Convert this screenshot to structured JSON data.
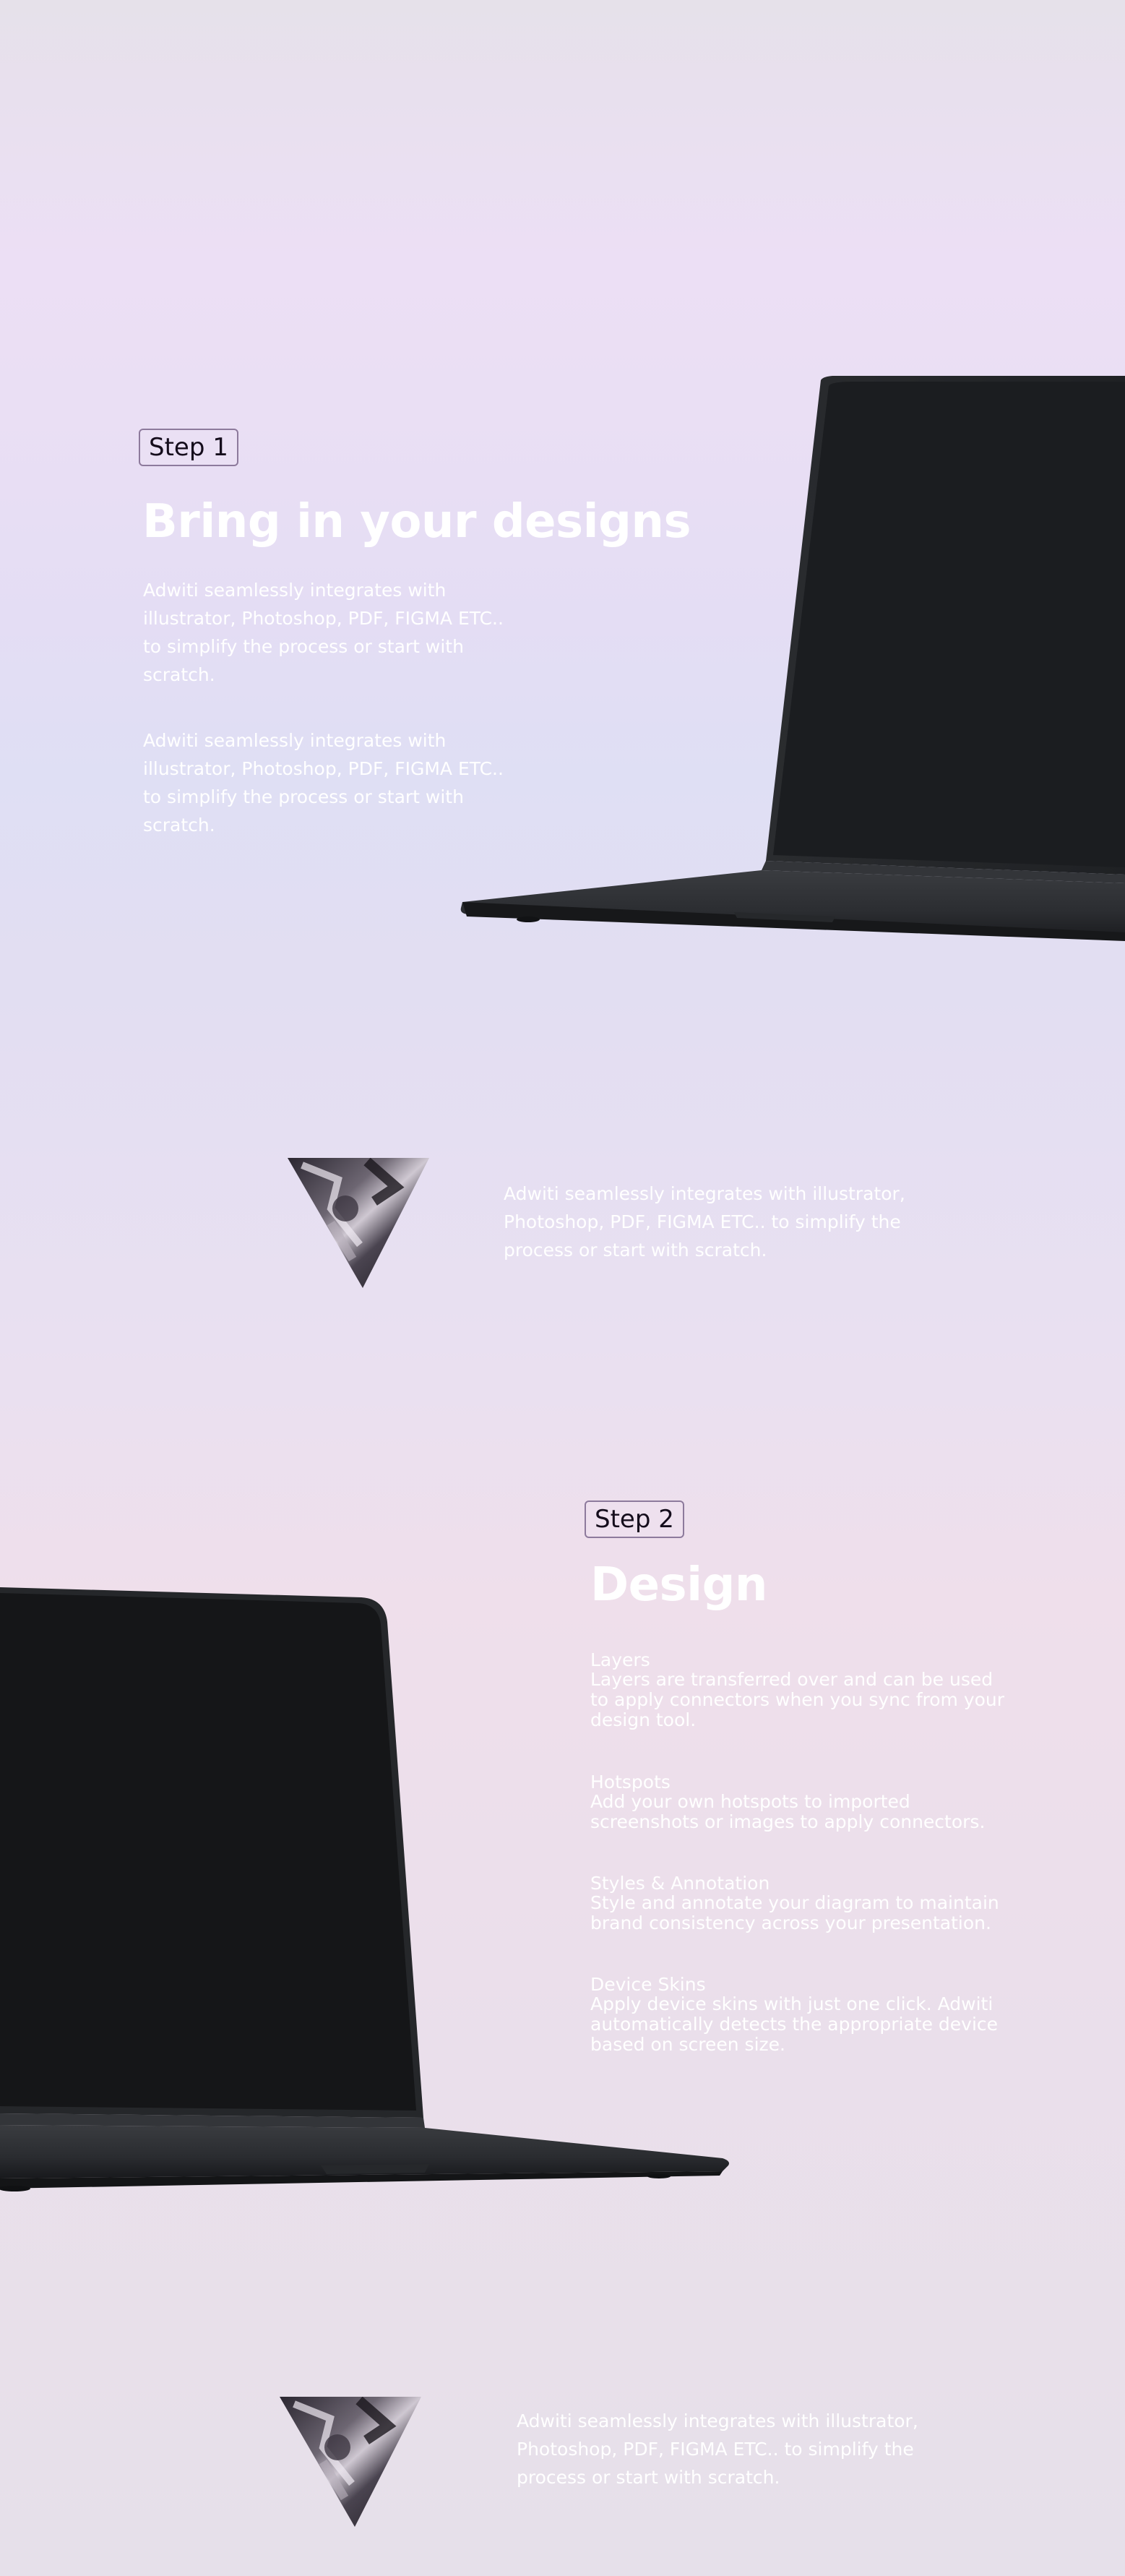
{
  "step1": {
    "badge": "Step 1",
    "heading": "Bring in your designs",
    "paragraphs": [
      "Adwiti seamlessly integrates with illustrator, Photoshop, PDF, FIGMA ETC.. to simplify the process or start with scratch.",
      "Adwiti seamlessly integrates with illustrator, Photoshop, PDF, FIGMA ETC.. to simplify the process or start with scratch."
    ]
  },
  "highlight1": {
    "text": "Adwiti seamlessly integrates with illustrator, Photoshop, PDF, FIGMA ETC.. to simplify the process or start with scratch."
  },
  "step2": {
    "badge": "Step 2",
    "heading": "Design",
    "features": [
      {
        "title": "Layers",
        "desc": "Layers are transferred over and can be used to apply connectors when you sync from your design tool."
      },
      {
        "title": "Hotspots",
        "desc": "Add your own hotspots to imported screenshots or images to apply connectors."
      },
      {
        "title": "Styles & Annotation",
        "desc": "Style and annotate your diagram to maintain brand consistency across your presentation."
      },
      {
        "title": "Device Skins",
        "desc": "Apply device skins with just one click. Adwiti automatically detects the appropriate device based on screen size."
      }
    ]
  },
  "highlight2": {
    "text": "Adwiti seamlessly integrates with illustrator, Photoshop, PDF, FIGMA ETC.. to simplify the process or start with scratch."
  },
  "icons": {
    "laptop_right": "laptop-mockup",
    "laptop_left": "laptop-mockup",
    "triangle": "abstract-triangle-image"
  },
  "colors": {
    "text": "#ffffff",
    "badge_text": "#150d1c",
    "badge_border": "#8d7a9c",
    "laptop_screen": "#1b1d20"
  }
}
